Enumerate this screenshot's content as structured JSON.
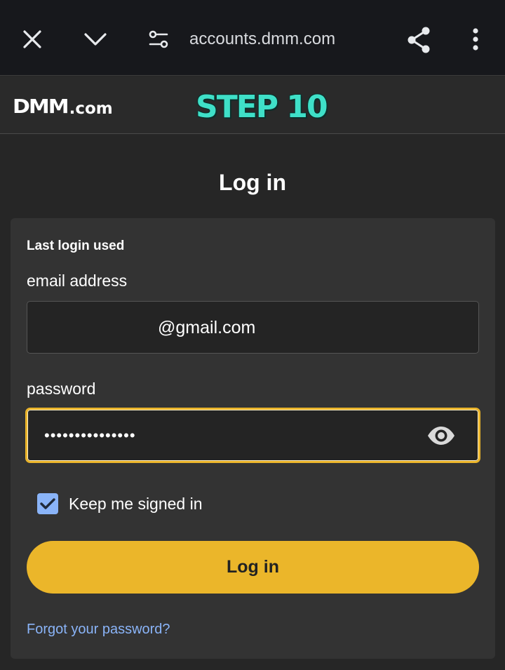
{
  "browser": {
    "url": "accounts.dmm.com",
    "icons": [
      "close-icon",
      "chevron-down-icon",
      "tune-icon",
      "share-icon",
      "more-vert-icon"
    ]
  },
  "site_header": {
    "logo_dmm": "DMM",
    "logo_com": ".com",
    "step_label": "STEP 10"
  },
  "page": {
    "title": "Log in"
  },
  "login_form": {
    "last_login_label": "Last login used",
    "email_label": "email address",
    "email_value": "@gmail.com",
    "password_label": "password",
    "password_value": "•••••••••••••••",
    "keep_signed_in_label": "Keep me signed in",
    "keep_signed_in_checked": true,
    "submit_label": "Log in",
    "forgot_password_label": "Forgot your password?"
  },
  "colors": {
    "accent_yellow": "#ebb62a",
    "step_teal": "#3fe0c8",
    "link_blue": "#8ab4f8",
    "checkbox_blue": "#8ab4f8"
  }
}
